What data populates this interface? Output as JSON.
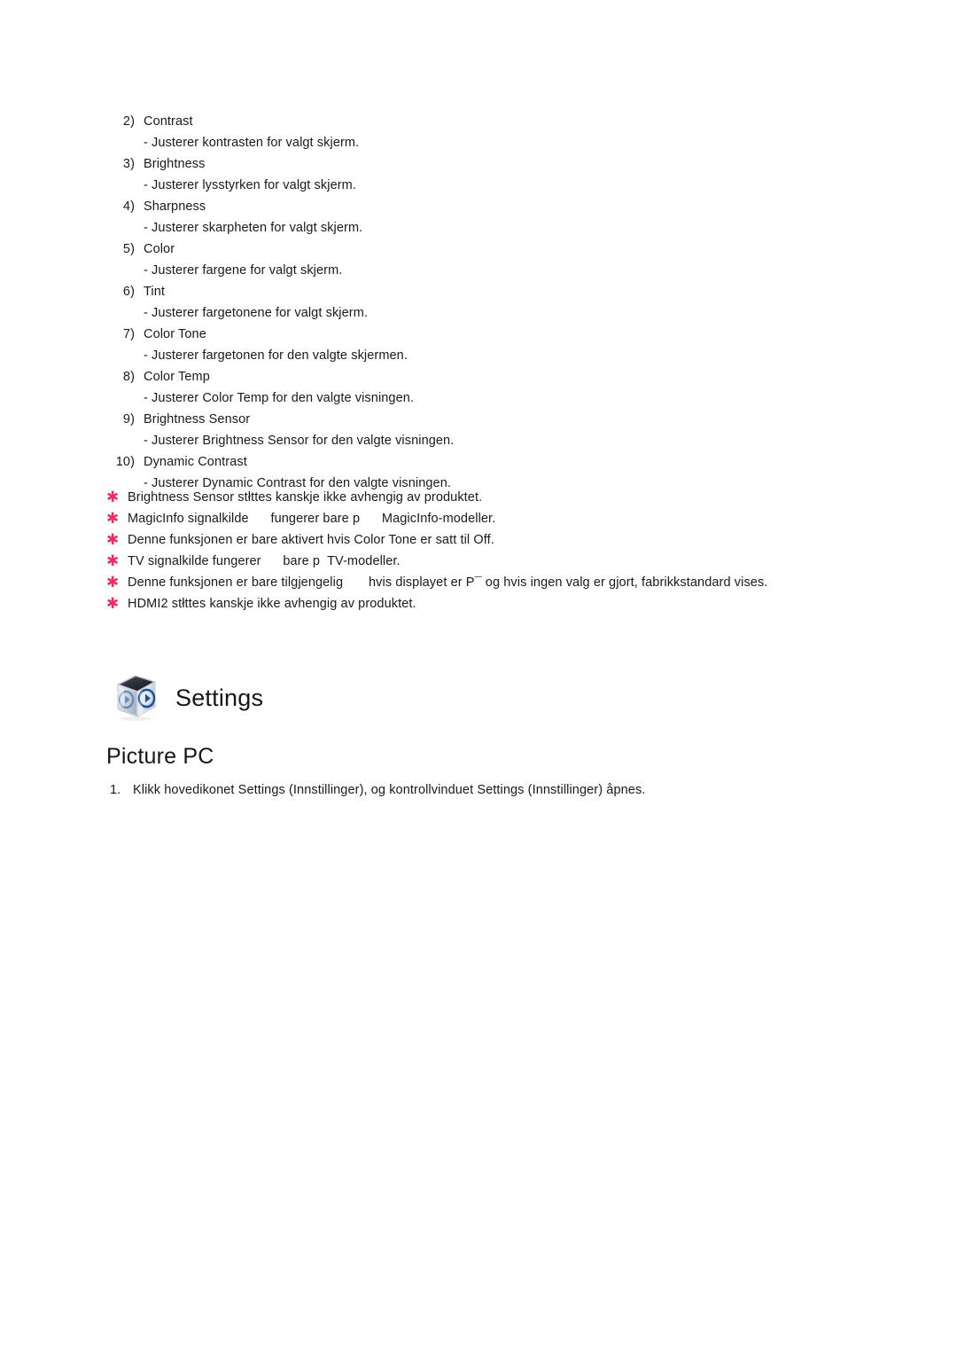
{
  "page": {
    "background_color": "#ffffff",
    "text_color": "#1a1a1a",
    "accent_color": "#ed2d63"
  },
  "numbered_list": [
    {
      "marker": "2)",
      "label": "Contrast",
      "desc": "- Justerer kontrasten for valgt skjerm."
    },
    {
      "marker": "3)",
      "label": "Brightness",
      "desc": "- Justerer lysstyrken for valgt skjerm."
    },
    {
      "marker": "4)",
      "label": "Sharpness",
      "desc": "- Justerer skarpheten for valgt skjerm."
    },
    {
      "marker": "5)",
      "label": "Color",
      "desc": "- Justerer fargene for valgt skjerm."
    },
    {
      "marker": "6)",
      "label": "Tint",
      "desc": "- Justerer fargetonene for valgt skjerm."
    },
    {
      "marker": "7)",
      "label": "Color Tone",
      "desc": "- Justerer fargetonen for den valgte skjermen."
    },
    {
      "marker": "8)",
      "label": "Color Temp",
      "desc": "- Justerer Color Temp for den valgte visningen."
    },
    {
      "marker": "9)",
      "label": "Brightness Sensor",
      "desc": "- Justerer Brightness Sensor for den valgte visningen."
    },
    {
      "marker": "10)",
      "label": "Dynamic Contrast",
      "desc": "- Justerer Dynamic Contrast for den valgte visningen."
    }
  ],
  "notes": {
    "star_glyph": "✱",
    "items": [
      {
        "text": "Brightness Sensor stłttes kanskje ikke avhengig av produktet."
      },
      {
        "text": "MagicInfo signalkilde      fungerer bare p      MagicInfo-modeller."
      },
      {
        "text": "Denne funksjonen er bare aktivert hvis Color Tone er satt til Off."
      },
      {
        "text": "TV signalkilde fungerer      bare p  TV-modeller."
      },
      {
        "text": "Denne funksjonen er bare tilgjengelig       hvis displayet er P¯ og hvis ingen valg er gjort, fabrikkstandard vises."
      },
      {
        "text": "HDMI2 stłttes kanskje ikke avhengig av produktet."
      }
    ]
  },
  "settings_section": {
    "icon_name": "settings-cube-icon",
    "title": "Settings"
  },
  "section_title": "Picture PC",
  "steps": [
    {
      "marker": "1.",
      "text": "Klikk hovedikonet Settings (Innstillinger), og kontrollvinduet Settings (Innstillinger) åpnes."
    }
  ]
}
